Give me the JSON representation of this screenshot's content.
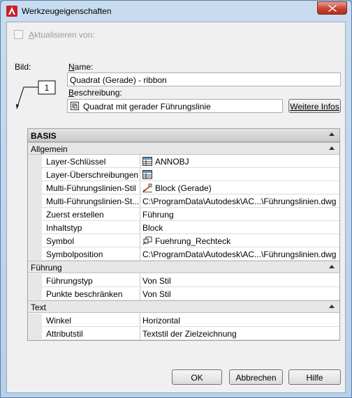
{
  "window": {
    "title": "Werkzeugeigenschaften"
  },
  "update_from": {
    "label": "Aktualisieren von:",
    "checked": false,
    "enabled": false
  },
  "image": {
    "label": "Bild:",
    "preview_number": "1"
  },
  "name": {
    "label": "Name:",
    "value": "Quadrat (Gerade) - ribbon"
  },
  "description": {
    "label": "Beschreibung:",
    "value": "Quadrat mit gerader Führungslinie"
  },
  "more_info_button": "Weitere Infos",
  "properties": {
    "header": "BASIS",
    "sections": [
      {
        "title": "Allgemein",
        "rows": [
          {
            "name": "Layer-Schlüssel",
            "value": "ANNOBJ",
            "icon": "table-icon"
          },
          {
            "name": "Layer-Überschreibungen",
            "value": "",
            "icon": "table-icon"
          },
          {
            "name": "Multi-Führungslinien-Stil",
            "value": "Block (Gerade)",
            "icon": "mleader-style-icon"
          },
          {
            "name": "Multi-Führungslinien-St...",
            "value": "C:\\ProgramData\\Autodesk\\AC...\\Führungslinien.dwg"
          },
          {
            "name": "Zuerst erstellen",
            "value": "Führung"
          },
          {
            "name": "Inhaltstyp",
            "value": "Block"
          },
          {
            "name": "Symbol",
            "value": "Fuehrung_Rechteck",
            "icon": "block-symbol-icon"
          },
          {
            "name": "Symbolposition",
            "value": "C:\\ProgramData\\Autodesk\\AC...\\Führungslinien.dwg"
          }
        ]
      },
      {
        "title": "Führung",
        "rows": [
          {
            "name": "Führungstyp",
            "value": "Von Stil"
          },
          {
            "name": "Punkte beschränken",
            "value": "Von Stil"
          }
        ]
      },
      {
        "title": "Text",
        "rows": [
          {
            "name": "Winkel",
            "value": "Horizontal"
          },
          {
            "name": "Attributstil",
            "value": "Textstil der Zielzeichnung"
          }
        ]
      }
    ]
  },
  "buttons": {
    "ok": "OK",
    "cancel": "Abbrechen",
    "help": "Hilfe"
  }
}
